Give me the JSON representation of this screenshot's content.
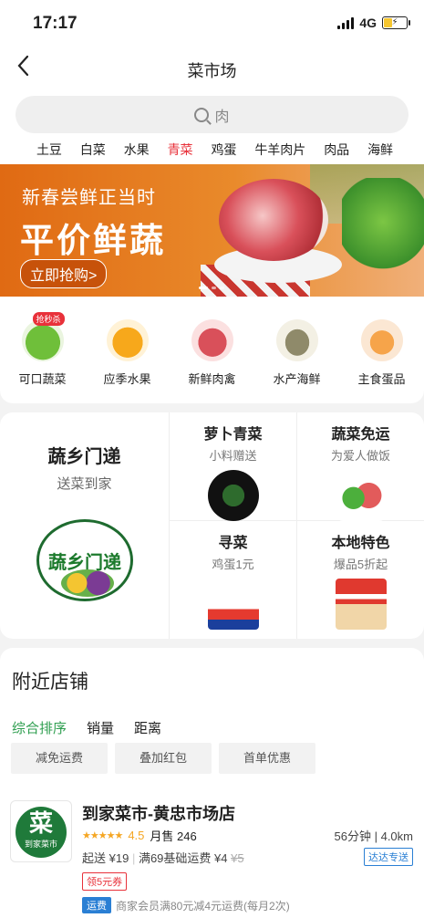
{
  "status_bar": {
    "time": "17:17",
    "network": "4G"
  },
  "nav": {
    "back_icon": "chevron-left-icon",
    "title": "菜市场"
  },
  "search": {
    "placeholder": "肉"
  },
  "hot_keywords": [
    "土豆",
    "白菜",
    "水果",
    "青菜",
    "鸡蛋",
    "牛羊肉片",
    "肉品",
    "海鲜"
  ],
  "active_keyword": "青菜",
  "banner": {
    "subtitle": "新春尝鲜正当时",
    "title": "平价鲜蔬",
    "button": "立即抢购>"
  },
  "categories": [
    {
      "label": "可口蔬菜",
      "tag": "抢秒杀"
    },
    {
      "label": "应季水果"
    },
    {
      "label": "新鲜肉禽"
    },
    {
      "label": "水产海鲜"
    },
    {
      "label": "主食蛋品"
    }
  ],
  "promo": {
    "main": {
      "title": "蔬乡门递",
      "subtitle": "送菜到家",
      "logo_text": "蔬乡门递"
    },
    "cells": [
      {
        "title": "萝卜青菜",
        "subtitle": "小料赠送"
      },
      {
        "title": "蔬菜免运",
        "subtitle": "为爱人做饭"
      },
      {
        "title": "寻菜",
        "subtitle": "鸡蛋1元"
      },
      {
        "title": "本地特色",
        "subtitle": "爆品5折起"
      }
    ]
  },
  "nearby": {
    "heading": "附近店铺",
    "sorts": [
      "综合排序",
      "销量",
      "距离"
    ],
    "filters": [
      "减免运费",
      "叠加红包",
      "首单优惠"
    ],
    "store": {
      "logo_char": "菜",
      "logo_text": "到家菜市",
      "name": "到家菜市-黄忠市场店",
      "stars": "★★★★★",
      "rating": "4.5",
      "monthly_sales": "月售 246",
      "eta_distance": "56分钟 | 4.0km",
      "min_order": "起送 ¥19",
      "base_fee": "满69基础运费 ¥4",
      "original_fee": "¥5",
      "delivery_type": "达达专送",
      "coupon": "领5元券",
      "freight_badge": "运费",
      "freight_text": "商家会员满80元减4元运费(每月2次)"
    }
  },
  "colors": {
    "accent_green": "#2e9e4f",
    "accent_red": "#e8313a",
    "banner_orange": "#e06a13",
    "express_blue": "#2a7fd4"
  }
}
